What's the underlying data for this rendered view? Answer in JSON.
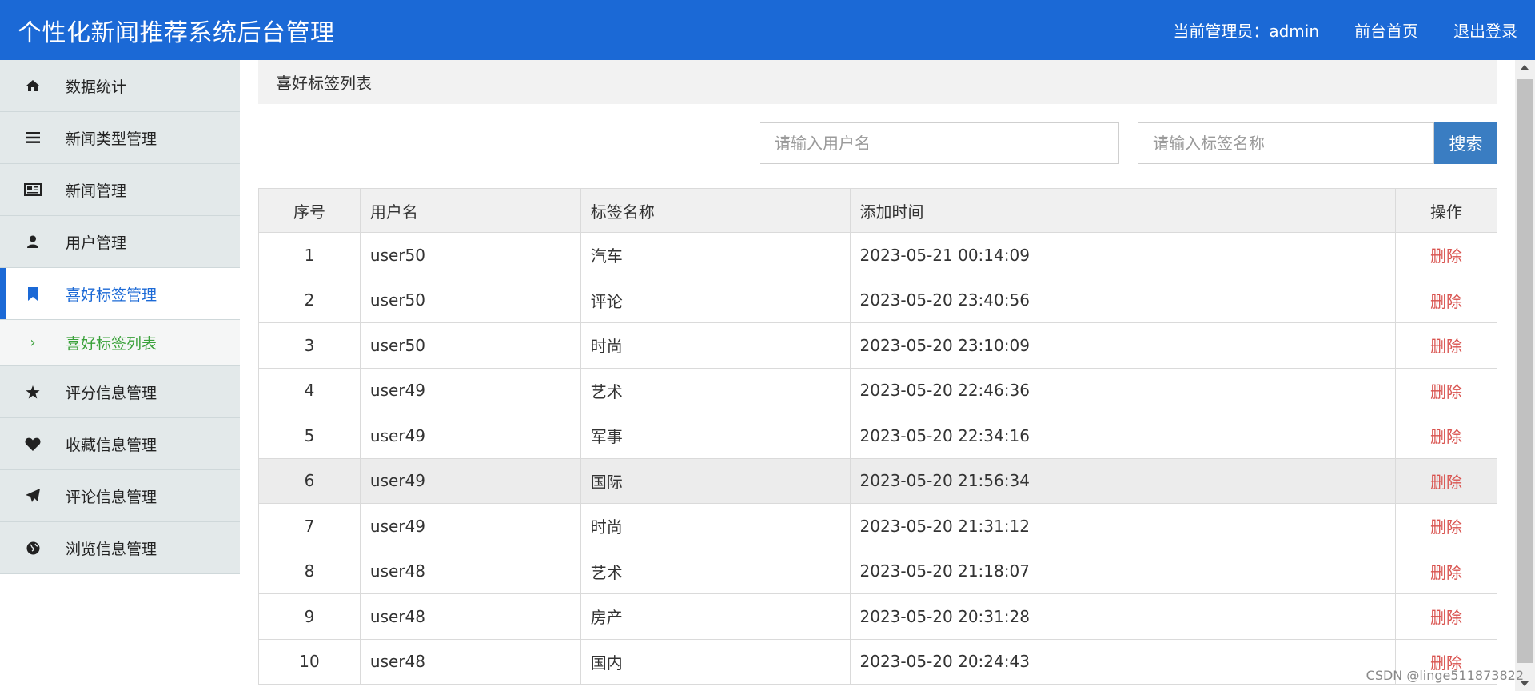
{
  "header": {
    "title": "个性化新闻推荐系统后台管理",
    "current_admin": "当前管理员：admin",
    "front_home": "前台首页",
    "logout": "退出登录"
  },
  "sidebar": {
    "items": [
      {
        "label": "数据统计",
        "icon": "home-icon"
      },
      {
        "label": "新闻类型管理",
        "icon": "list-icon"
      },
      {
        "label": "新闻管理",
        "icon": "newspaper-icon"
      },
      {
        "label": "用户管理",
        "icon": "user-icon"
      },
      {
        "label": "喜好标签管理",
        "icon": "bookmark-icon",
        "active": true
      },
      {
        "label": "评分信息管理",
        "icon": "star-icon"
      },
      {
        "label": "收藏信息管理",
        "icon": "heart-icon"
      },
      {
        "label": "评论信息管理",
        "icon": "send-icon"
      },
      {
        "label": "浏览信息管理",
        "icon": "globe-icon"
      }
    ],
    "submenu": {
      "label": "喜好标签列表",
      "icon": "chevron-right-icon"
    }
  },
  "panel": {
    "title": "喜好标签列表"
  },
  "search": {
    "username_placeholder": "请输入用户名",
    "tag_placeholder": "请输入标签名称",
    "button": "搜索"
  },
  "table": {
    "headers": [
      "序号",
      "用户名",
      "标签名称",
      "添加时间",
      "操作"
    ],
    "rows": [
      {
        "no": "1",
        "user": "user50",
        "tag": "汽车",
        "time": "2023-05-21 00:14:09",
        "op": "删除"
      },
      {
        "no": "2",
        "user": "user50",
        "tag": "评论",
        "time": "2023-05-20 23:40:56",
        "op": "删除"
      },
      {
        "no": "3",
        "user": "user50",
        "tag": "时尚",
        "time": "2023-05-20 23:10:09",
        "op": "删除"
      },
      {
        "no": "4",
        "user": "user49",
        "tag": "艺术",
        "time": "2023-05-20 22:46:36",
        "op": "删除"
      },
      {
        "no": "5",
        "user": "user49",
        "tag": "军事",
        "time": "2023-05-20 22:34:16",
        "op": "删除"
      },
      {
        "no": "6",
        "user": "user49",
        "tag": "国际",
        "time": "2023-05-20 21:56:34",
        "op": "删除"
      },
      {
        "no": "7",
        "user": "user49",
        "tag": "时尚",
        "time": "2023-05-20 21:31:12",
        "op": "删除"
      },
      {
        "no": "8",
        "user": "user48",
        "tag": "艺术",
        "time": "2023-05-20 21:18:07",
        "op": "删除"
      },
      {
        "no": "9",
        "user": "user48",
        "tag": "房产",
        "time": "2023-05-20 20:31:28",
        "op": "删除"
      },
      {
        "no": "10",
        "user": "user48",
        "tag": "国内",
        "time": "2023-05-20 20:24:43",
        "op": "删除"
      }
    ]
  },
  "watermark": "CSDN @linge511873822",
  "colors": {
    "primary": "#1b69d6",
    "danger": "#d9534f",
    "submenu_green": "#3aa13a",
    "button": "#3a7dc2"
  }
}
